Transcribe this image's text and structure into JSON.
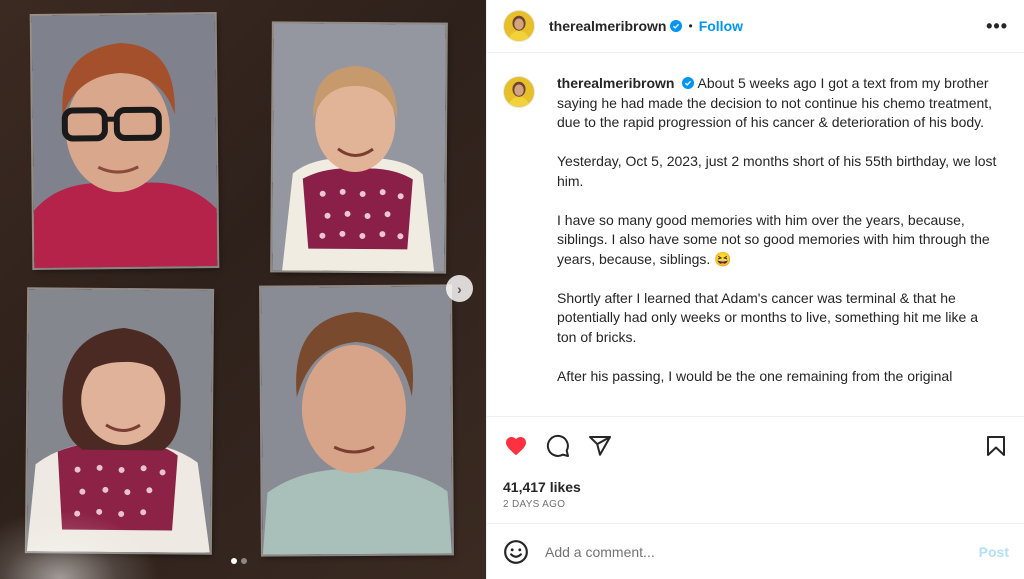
{
  "header": {
    "username": "therealmeribrown",
    "separator": "•",
    "follow_label": "Follow",
    "more_label": "•••"
  },
  "media": {
    "carousel_count": 2,
    "carousel_active": 1,
    "next_label": "›"
  },
  "caption": {
    "username": "therealmeribrown",
    "paragraphs": [
      "About 5 weeks ago I got a text from my brother saying he had made the decision to not continue his chemo treatment, due to the rapid progression of his cancer & deterioration of his body.",
      "Yesterday, Oct 5, 2023, just 2 months short of his 55th birthday, we lost him.",
      "I have so many good memories with him over the years, because, siblings. I also have some not so good memories with him through the years, because, siblings. 😆",
      "Shortly after I learned that Adam's cancer was terminal & that he potentially had only weeks or months to live, something hit me like a ton of bricks.",
      "After his passing, I would be the one remaining from the original"
    ]
  },
  "actions": {
    "like_icon": "heart-filled-icon",
    "comment_icon": "comment-icon",
    "share_icon": "share-icon",
    "save_icon": "bookmark-icon",
    "like_color": "#ff3040"
  },
  "stats": {
    "likes": "41,417 likes",
    "timestamp": "2 DAYS AGO"
  },
  "comment": {
    "placeholder": "Add a comment...",
    "post_label": "Post",
    "post_color": "#b2dffc",
    "emoji_icon": "smiley-icon"
  },
  "colors": {
    "accent": "#0095f6",
    "verified": "#0095f6",
    "border": "#efefef",
    "muted_text": "#737373"
  }
}
